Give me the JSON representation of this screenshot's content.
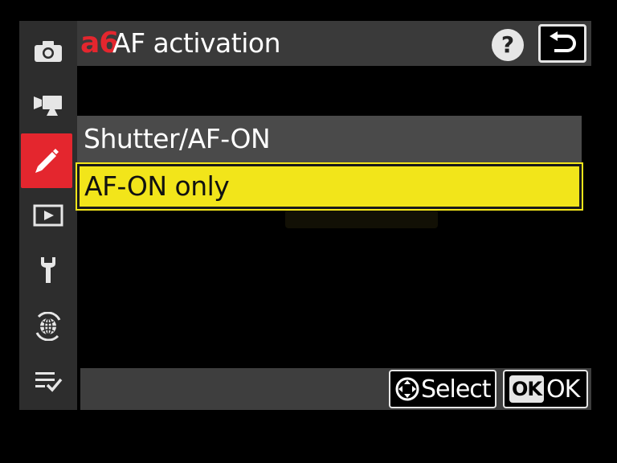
{
  "header": {
    "menu_code": "a6",
    "title": "AF activation",
    "help_label": "?",
    "back_icon": "return-arrow-icon"
  },
  "tabs": [
    {
      "name": "photo-shooting",
      "icon": "camera-icon",
      "active": false
    },
    {
      "name": "movie-recording",
      "icon": "movie-camera-icon",
      "active": false
    },
    {
      "name": "custom-settings",
      "icon": "pencil-icon",
      "active": true
    },
    {
      "name": "playback",
      "icon": "play-icon",
      "active": false
    },
    {
      "name": "setup",
      "icon": "wrench-icon",
      "active": false
    },
    {
      "name": "network",
      "icon": "globe-network-icon",
      "active": false
    },
    {
      "name": "my-menu",
      "icon": "checklist-icon",
      "active": false
    }
  ],
  "options": [
    {
      "label": "Shutter/AF-ON",
      "selected": false
    },
    {
      "label": "AF-ON only",
      "selected": true
    }
  ],
  "footer": {
    "select_label": "Select",
    "ok_key": "OK",
    "ok_label": "OK"
  },
  "colors": {
    "accent_red": "#e4262e",
    "highlight_yellow": "#f2e51a",
    "rail_bg": "#2d2d2d",
    "header_bg": "#3a3a3a"
  }
}
